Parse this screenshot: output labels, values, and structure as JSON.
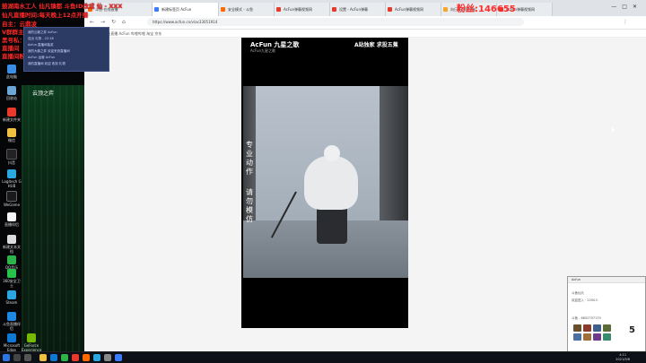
{
  "overlay": {
    "lines": [
      "鼓湖南水工人 仙凡镇都 斗鱼ID改成 仙 - XXX",
      "仙凡直播时间:每天晚上12点开播",
      "自主：云鼎凌",
      "V群群主开炮 安排群",
      "黑号私：sohighluu",
      "直播间",
      "直播间粉丝满26级送IPHONE13"
    ],
    "right_text": "粉丝:146655"
  },
  "small_window": {
    "lines": [
      "我的云鼎之弈 AcFun",
      "送出 礼物 - 22:18",
      "Acfun 直播间抽奖",
      "我的大鼎之弈 欢迎来到直播间",
      "AcFun 运营 AcFun",
      "我的直播间 欢迎 收到 礼物"
    ]
  },
  "desktop": {
    "icons": [
      "此电脑",
      "回收站",
      "腾讯QQ",
      "新建文件夹",
      "微信",
      "抖音",
      "Logitech G HUB",
      "斗鱼直播伴侣",
      "WeGame",
      "直播伴侣",
      "新建文本文档",
      "QQ音乐",
      "Steam",
      "360安全卫士",
      "Microsoft Edge",
      "GeForce Experience"
    ],
    "game_label": "云顶之弈"
  },
  "browser": {
    "tabs": [
      {
        "label": "斗鱼-在线直播",
        "color": "#ff6a00"
      },
      {
        "label": "新建标签页 AcFun",
        "color": "#3b7cff"
      },
      {
        "label": "安全模式 - 斗鱼",
        "color": "#ff6a00"
      },
      {
        "label": "AcFun弹幕视频网",
        "color": "#e8392a"
      },
      {
        "label": "设置 - AcFun弹幕",
        "color": "#e8392a"
      },
      {
        "label": "AcFun弹幕视频网",
        "color": "#e8392a"
      },
      {
        "label": "向日葵远程控制",
        "color": "#f5a623"
      },
      {
        "label": "AcFun弹幕视频网",
        "color": "#e8392a"
      }
    ],
    "url": "https://www.acfun.cn/v/ac33051914",
    "bookmarks": "书签栏  斗鱼直播  AcFun  哔哩哔哩  淘宝  京东"
  },
  "video": {
    "logo": "AcFun 九星之歌",
    "sub": "AcFun九星之歌",
    "heading": "A站独家 求投五蕉",
    "side_text_1": "专业动作",
    "side_text_2": "请勿模仿"
  },
  "chat": {
    "title": "Acfun",
    "lines": [
      "斗鱼仙凡 ",
      "欢迎进入 · 2200人",
      "",
      "斗鱼 - 6652797179"
    ],
    "count": "5"
  },
  "taskbar": {
    "time": "4:11",
    "date": "2021/9/8"
  }
}
